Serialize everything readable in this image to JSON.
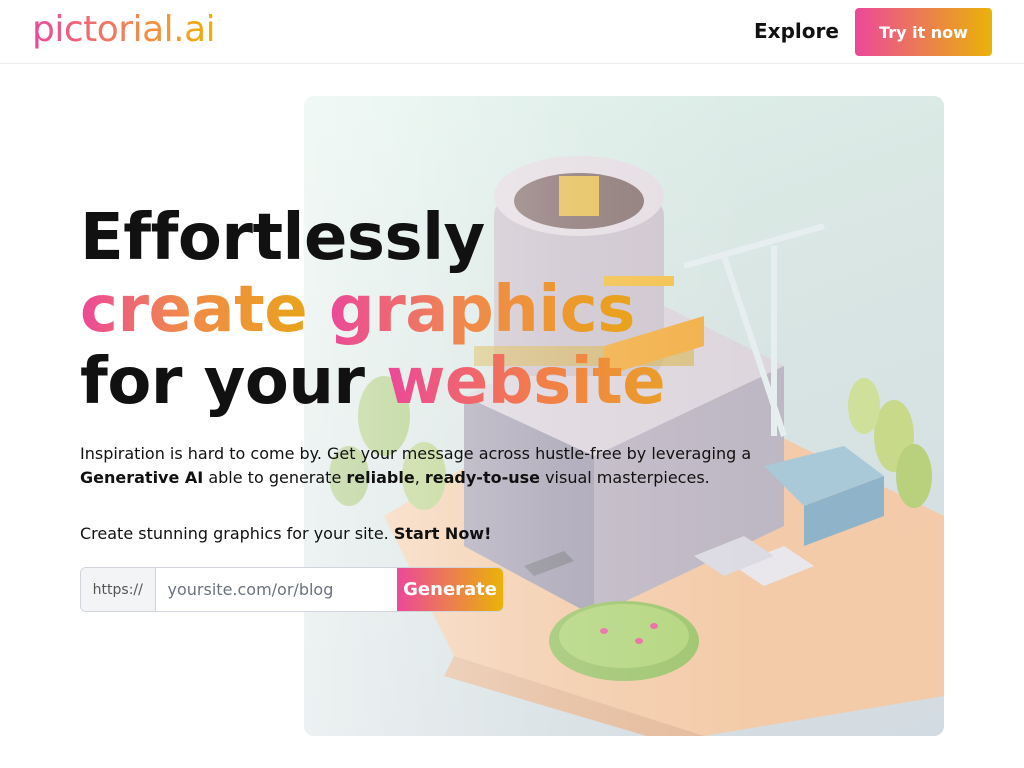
{
  "brand": {
    "logo_text": "pictorial.ai"
  },
  "nav": {
    "explore_label": "Explore",
    "cta_label": "Try it now"
  },
  "hero": {
    "line1": "Effortlessly",
    "line2_a": "create",
    "line2_b": "graphics",
    "line3_a": "for your",
    "line3_b": "website",
    "lede": {
      "part1": "Inspiration is hard to come by. Get your message across hustle-free by leveraging a",
      "bold1": "Generative AI",
      "part2": "able to generate",
      "bold2": "reliable",
      "sep": ",",
      "bold3": "ready-to-use",
      "part3": "visual masterpieces."
    },
    "cta_text": "Create stunning graphics for your site.",
    "cta_bold": "Start Now!",
    "image_icon": "isometric-city-illustration"
  },
  "form": {
    "prefix": "https://",
    "placeholder": "yoursite.com/or/blog",
    "value": "",
    "button_label": "Generate"
  },
  "colors": {
    "gradient_start": "#ec4899",
    "gradient_end": "#eab308",
    "text": "#111111"
  }
}
